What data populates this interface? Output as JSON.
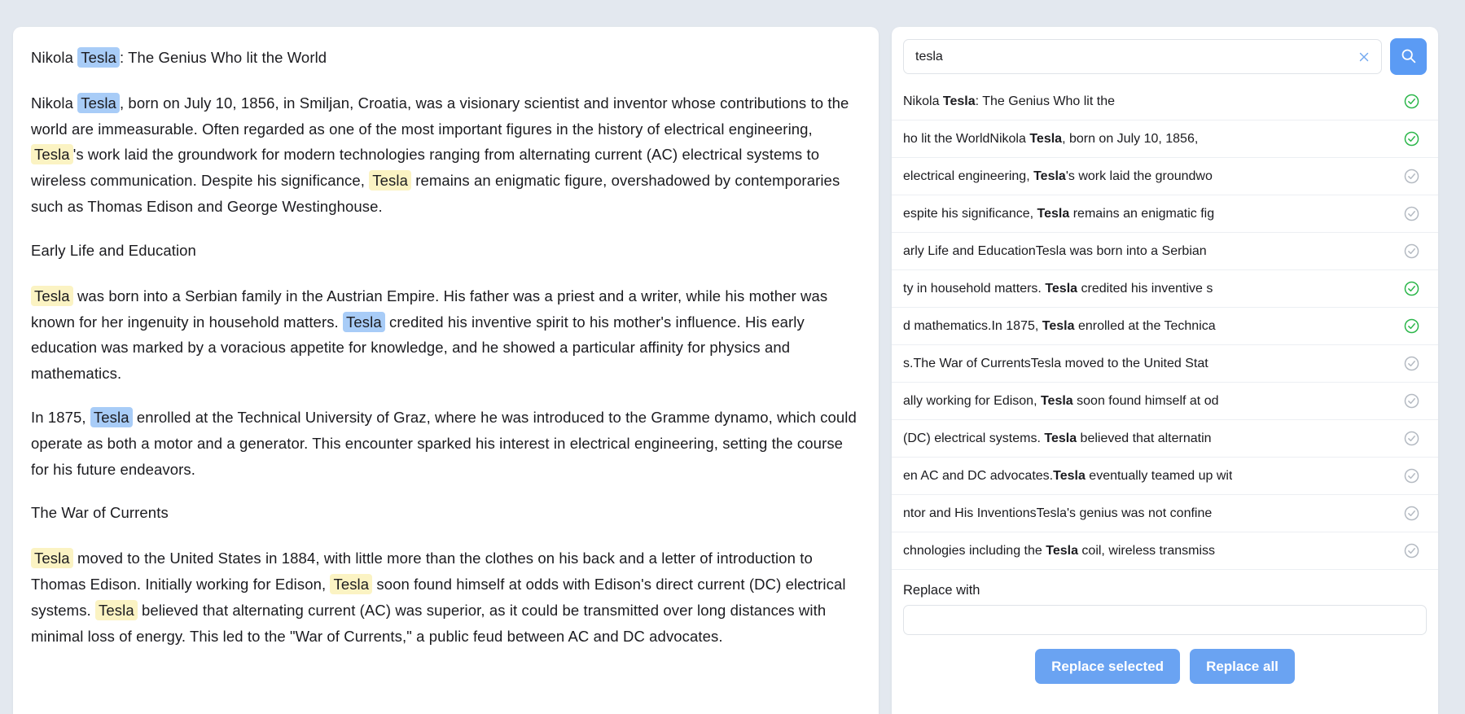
{
  "document": {
    "blocks": [
      {
        "type": "heading",
        "runs": [
          {
            "t": "Nikola ",
            "h": "none"
          },
          {
            "t": "Tesla",
            "h": "blue"
          },
          {
            "t": ": The Genius Who lit the World",
            "h": "none"
          }
        ]
      },
      {
        "type": "paragraph",
        "runs": [
          {
            "t": "Nikola ",
            "h": "none"
          },
          {
            "t": "Tesla",
            "h": "blue"
          },
          {
            "t": ", born on July 10, 1856, in Smiljan, Croatia, was a visionary scientist and inventor whose contributions to the world are immeasurable. Often regarded as one of the most important figures in the history of electrical engineering, ",
            "h": "none"
          },
          {
            "t": "Tesla",
            "h": "yellow"
          },
          {
            "t": "'s work laid the groundwork for modern technologies ranging from alternating current (AC) electrical systems to wireless communication. Despite his significance, ",
            "h": "none"
          },
          {
            "t": "Tesla",
            "h": "yellow"
          },
          {
            "t": " remains an enigmatic figure, overshadowed by contemporaries such as Thomas Edison and George Westinghouse.",
            "h": "none"
          }
        ]
      },
      {
        "type": "heading",
        "runs": [
          {
            "t": "Early Life and Education",
            "h": "none"
          }
        ]
      },
      {
        "type": "paragraph",
        "runs": [
          {
            "t": "Tesla",
            "h": "yellow"
          },
          {
            "t": " was born into a Serbian family in the Austrian Empire. His father was a priest and a writer, while his mother was known for her ingenuity in household matters. ",
            "h": "none"
          },
          {
            "t": "Tesla",
            "h": "blue"
          },
          {
            "t": " credited his inventive spirit to his mother's influence. His early education was marked by a voracious appetite for knowledge, and he showed a particular affinity for physics and mathematics.",
            "h": "none"
          }
        ]
      },
      {
        "type": "paragraph",
        "runs": [
          {
            "t": "In 1875, ",
            "h": "none"
          },
          {
            "t": "Tesla",
            "h": "blue"
          },
          {
            "t": " enrolled at the Technical University of Graz, where he was introduced to the Gramme dynamo, which could operate as both a motor and a generator. This encounter sparked his interest in electrical engineering, setting the course for his future endeavors.",
            "h": "none"
          }
        ]
      },
      {
        "type": "heading",
        "runs": [
          {
            "t": "The War of Currents",
            "h": "none"
          }
        ]
      },
      {
        "type": "paragraph",
        "runs": [
          {
            "t": "Tesla",
            "h": "yellow"
          },
          {
            "t": " moved to the United States in 1884, with little more than the clothes on his back and a letter of introduction to Thomas Edison. Initially working for Edison, ",
            "h": "none"
          },
          {
            "t": "Tesla",
            "h": "yellow"
          },
          {
            "t": " soon found himself at odds with Edison's direct current (DC) electrical systems. ",
            "h": "none"
          },
          {
            "t": "Tesla",
            "h": "yellow"
          },
          {
            "t": " believed that alternating current (AC) was superior, as it could be transmitted over long distances with minimal loss of energy. This led to the \"War of Currents,\" a public feud between AC and DC advocates.",
            "h": "none"
          }
        ]
      }
    ]
  },
  "search": {
    "query": "tesla",
    "placeholder": "",
    "clear_icon": "close-icon",
    "search_icon": "search-icon",
    "results": [
      {
        "pre": "Nikola ",
        "match": "Tesla",
        "post": ": The Genius Who lit the",
        "selected": true
      },
      {
        "pre": "ho lit the WorldNikola ",
        "match": "Tesla",
        "post": ", born on July 10, 1856,",
        "selected": true
      },
      {
        "pre": "electrical engineering, ",
        "match": "Tesla",
        "post": "'s work laid the groundwo",
        "selected": false
      },
      {
        "pre": "espite his significance, ",
        "match": "Tesla",
        "post": " remains an enigmatic fig",
        "selected": false
      },
      {
        "pre": "arly Life and EducationTesla was born into a Serbian",
        "match": "",
        "post": "",
        "selected": false
      },
      {
        "pre": "ty in household matters. ",
        "match": "Tesla",
        "post": " credited his inventive s",
        "selected": true
      },
      {
        "pre": "d mathematics.In 1875, ",
        "match": "Tesla",
        "post": " enrolled at the Technica",
        "selected": true
      },
      {
        "pre": "s.The War of CurrentsTesla moved to the United Stat",
        "match": "",
        "post": "",
        "selected": false
      },
      {
        "pre": "ally working for Edison, ",
        "match": "Tesla",
        "post": " soon found himself at od",
        "selected": false
      },
      {
        "pre": "(DC) electrical systems. ",
        "match": "Tesla",
        "post": " believed that alternatin",
        "selected": false
      },
      {
        "pre": "en AC and DC advocates.",
        "match": "Tesla",
        "post": " eventually teamed up wit",
        "selected": false
      },
      {
        "pre": "ntor and His InventionsTesla's genius was not confine",
        "match": "",
        "post": "",
        "selected": false
      },
      {
        "pre": "chnologies including the ",
        "match": "Tesla",
        "post": " coil, wireless transmiss",
        "selected": false
      }
    ],
    "replace_label": "Replace with",
    "replace_value": "",
    "replace_placeholder": "",
    "replace_selected_label": "Replace selected",
    "replace_all_label": "Replace all"
  },
  "colors": {
    "accent_blue": "#6aa3f2",
    "search_button_blue": "#5b9bf4",
    "highlight_blue": "#a8ccf7",
    "highlight_yellow": "#fbf3c3",
    "check_selected_green": "#2bb64a",
    "check_unselected_gray": "#b4bac2",
    "page_background": "#e3e8ef",
    "card_background": "#ffffff"
  }
}
